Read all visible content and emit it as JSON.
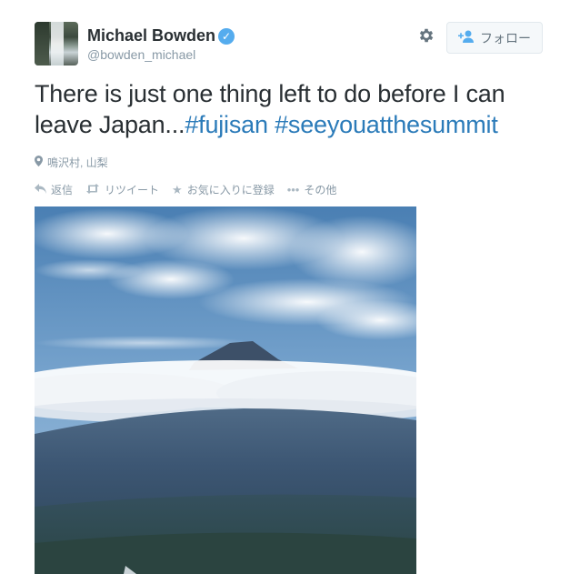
{
  "user": {
    "name": "Michael Bowden",
    "handle": "@bowden_michael",
    "verified": true
  },
  "header": {
    "follow_label": "フォロー",
    "gear_icon": "gear-icon",
    "follow_icon": "add-user-icon"
  },
  "tweet": {
    "text_plain": "There is just one thing left to do before I can leave Japan...",
    "hashtag1": "#fujisan",
    "hashtag2": "#seeyouatthesummit"
  },
  "location": {
    "label": "鳴沢村, 山梨",
    "icon": "pin-icon"
  },
  "actions": {
    "reply": "返信",
    "retweet": "リツイート",
    "favorite": "お気に入りに登録",
    "more": "その他"
  },
  "colors": {
    "link": "#2b7bb9",
    "verified": "#55acee",
    "muted": "#8899a6"
  }
}
